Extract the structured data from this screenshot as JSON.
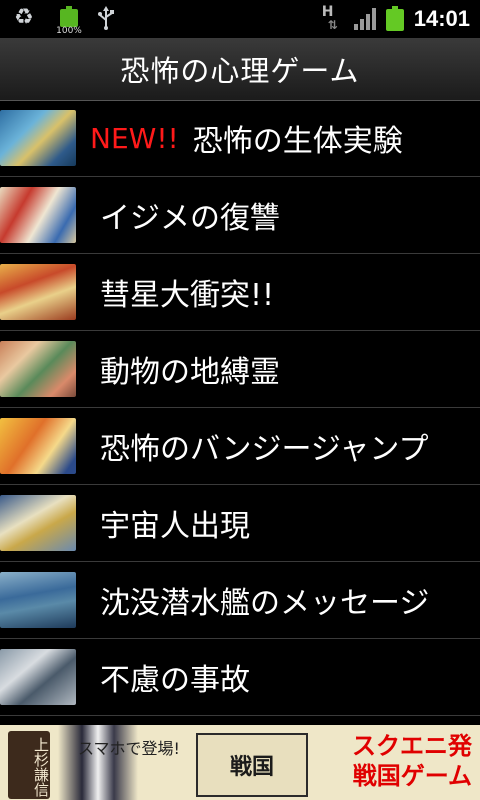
{
  "status_bar": {
    "battery_small_percent": "100%",
    "network_type": "H",
    "time": "14:01",
    "icons": [
      "recycle-icon",
      "battery-icon",
      "usb-icon",
      "hsdpa-icon",
      "signal-icon",
      "battery-icon"
    ]
  },
  "app": {
    "title": "恐怖の心理ゲーム"
  },
  "list": {
    "items": [
      {
        "badge": "NEW!!",
        "label": "恐怖の生体実験"
      },
      {
        "label": "イジメの復讐"
      },
      {
        "label": "彗星大衝突!!"
      },
      {
        "label": "動物の地縛霊"
      },
      {
        "label": "恐怖のバンジージャンプ"
      },
      {
        "label": "宇宙人出現"
      },
      {
        "label": "沈没潜水艦のメッセージ"
      },
      {
        "label": "不慮の事故"
      }
    ]
  },
  "ad_banner": {
    "tag": "上杉謙信",
    "sub_text": "スマホで登場!",
    "logo_text": "戦国",
    "headline_line1": "スクエニ発",
    "headline_line2": "戦国ゲーム"
  },
  "colors": {
    "background": "#000000",
    "new_badge": "#ff1a1a",
    "battery": "#64c924",
    "ad_headline": "#e00000"
  }
}
